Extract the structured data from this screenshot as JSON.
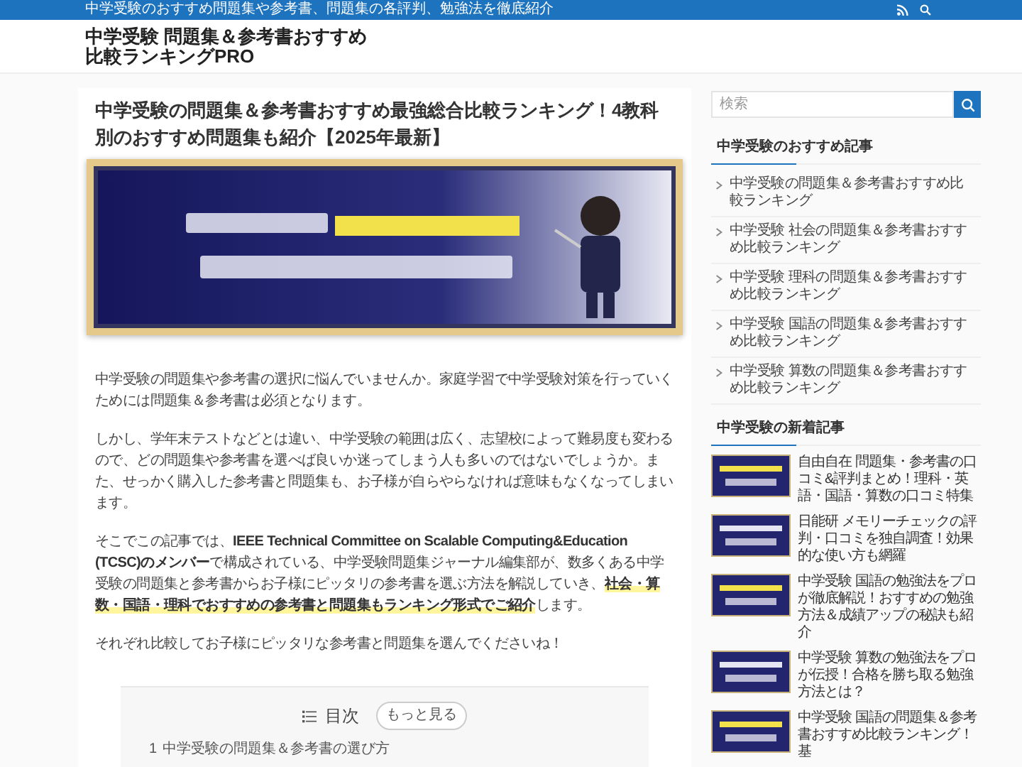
{
  "top_bar": {
    "tagline": "中学受験のおすすめ問題集や参考書、問題集の各評判、勉強法を徹底紹介"
  },
  "header": {
    "site_title": "中学受験 問題集＆参考書おすすめ比較ランキングPRO"
  },
  "article": {
    "title": "中学受験の問題集＆参考書おすすめ最強総合比較ランキング！4教科別のおすすめ問題集も紹介【2025年最新】",
    "paragraphs": [
      [
        {
          "kind": "plain",
          "text": "中学受験の問題集や参考書の選択に悩んでいませんか。家庭学習で中学受験対策を行っていくためには問題集＆参考書は必須となります。"
        }
      ],
      [
        {
          "kind": "plain",
          "text": "しかし、学年末テストなどとは違い、中学受験の範囲は広く、志望校によって難易度も変わるので、どの問題集や参考書を選べば良いか迷ってしまう人も多いのではないでしょうか。また、せっかく購入した参考書と問題集も、お子様が自らやらなければ意味もなくなってしまいます。"
        }
      ],
      [
        {
          "kind": "plain",
          "text": "そこでこの記事では、"
        },
        {
          "kind": "bold",
          "text": "IEEE Technical Committee on Scalable Computing&Education (TCSC)のメンバー"
        },
        {
          "kind": "plain",
          "text": "で構成されている、中学受験問題集ジャーナル編集部が、数多くある中学受験の問題集と参考書からお子様にピッタリの参考書を選ぶ方法を解説していき、"
        },
        {
          "kind": "marker",
          "text": "社会・算数・国語・理科でおすすめの参考書と問題集もランキング形式でご紹介"
        },
        {
          "kind": "plain",
          "text": "します。"
        }
      ],
      [
        {
          "kind": "plain",
          "text": "それぞれ比較してお子様にピッタリな参考書と問題集を選んでくださいね！"
        }
      ]
    ],
    "toc": {
      "title": "目次",
      "toggle": "もっと見る",
      "items": [
        {
          "number": "1",
          "text": "中学受験の問題集＆参考書の選び方"
        }
      ]
    }
  },
  "sidebar": {
    "search": {
      "placeholder": "検索"
    },
    "popular": {
      "title": "中学受験のおすすめ記事",
      "items": [
        "中学受験の問題集＆参考書おすすめ比較ランキング",
        "中学受験 社会の問題集＆参考書おすすめ比較ランキング",
        "中学受験 理科の問題集＆参考書おすすめ比較ランキング",
        "中学受験 国語の問題集＆参考書おすすめ比較ランキング",
        "中学受験 算数の問題集＆参考書おすすめ比較ランキング"
      ]
    },
    "recent": {
      "title": "中学受験の新着記事",
      "items": [
        {
          "kind": "picture",
          "text": "自由自在 問題集・参考書の口コミ&評判まとめ！理科・英語・国語・算数の口コミ特集"
        },
        {
          "kind": "picture",
          "text": "日能研 メモリーチェックの評判・口コミを独自調査！効果的な使い方も網羅"
        },
        {
          "kind": "picture",
          "text": "中学受験 国語の勉強法をプロが徹底解説！おすすめの勉強方法＆成績アップの秘訣も紹介"
        },
        {
          "kind": "picture",
          "text": "中学受験 算数の勉強法をプロが伝授！合格を勝ち取る勉強方法とは？"
        },
        {
          "kind": "picture",
          "text": "中学受験 国語の問題集＆参考書おすすめ比較ランキング！基"
        }
      ]
    }
  }
}
